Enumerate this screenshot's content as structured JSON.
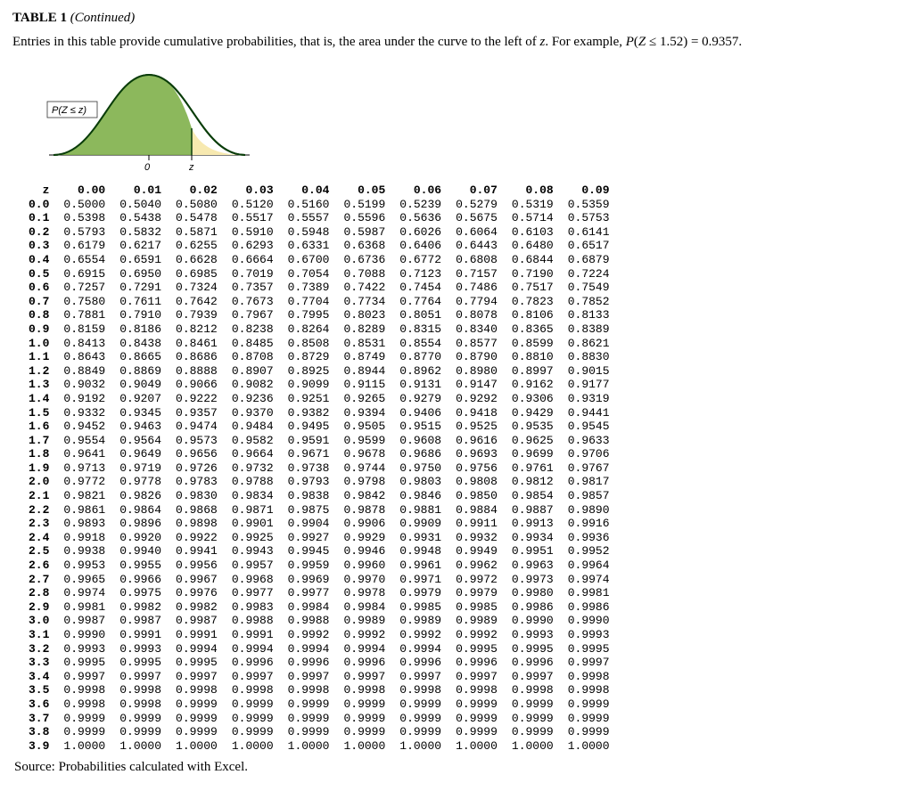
{
  "title_prefix": "TABLE 1 ",
  "title_paren": "(Continued)",
  "description_parts": {
    "p1": "Entries in this table provide cumulative probabilities, that is, the area under the curve to the left of ",
    "zvar": "z",
    "p2": ". For example, ",
    "pvar": "P",
    "p3": "(",
    "Zvar": "Z",
    "p4": " ≤ 1.52) = 0.9357."
  },
  "diagram": {
    "label_left": "P(Z ≤ z)",
    "tick0": "0",
    "tickz": "z"
  },
  "chart_data": {
    "type": "table",
    "title": "Standard normal cumulative distribution table",
    "corner_label": "z",
    "col_headers": [
      "0.00",
      "0.01",
      "0.02",
      "0.03",
      "0.04",
      "0.05",
      "0.06",
      "0.07",
      "0.08",
      "0.09"
    ],
    "row_labels": [
      "0.0",
      "0.1",
      "0.2",
      "0.3",
      "0.4",
      "0.5",
      "0.6",
      "0.7",
      "0.8",
      "0.9",
      "1.0",
      "1.1",
      "1.2",
      "1.3",
      "1.4",
      "1.5",
      "1.6",
      "1.7",
      "1.8",
      "1.9",
      "2.0",
      "2.1",
      "2.2",
      "2.3",
      "2.4",
      "2.5",
      "2.6",
      "2.7",
      "2.8",
      "2.9",
      "3.0",
      "3.1",
      "3.2",
      "3.3",
      "3.4",
      "3.5",
      "3.6",
      "3.7",
      "3.8",
      "3.9"
    ],
    "values": [
      [
        "0.5000",
        "0.5040",
        "0.5080",
        "0.5120",
        "0.5160",
        "0.5199",
        "0.5239",
        "0.5279",
        "0.5319",
        "0.5359"
      ],
      [
        "0.5398",
        "0.5438",
        "0.5478",
        "0.5517",
        "0.5557",
        "0.5596",
        "0.5636",
        "0.5675",
        "0.5714",
        "0.5753"
      ],
      [
        "0.5793",
        "0.5832",
        "0.5871",
        "0.5910",
        "0.5948",
        "0.5987",
        "0.6026",
        "0.6064",
        "0.6103",
        "0.6141"
      ],
      [
        "0.6179",
        "0.6217",
        "0.6255",
        "0.6293",
        "0.6331",
        "0.6368",
        "0.6406",
        "0.6443",
        "0.6480",
        "0.6517"
      ],
      [
        "0.6554",
        "0.6591",
        "0.6628",
        "0.6664",
        "0.6700",
        "0.6736",
        "0.6772",
        "0.6808",
        "0.6844",
        "0.6879"
      ],
      [
        "0.6915",
        "0.6950",
        "0.6985",
        "0.7019",
        "0.7054",
        "0.7088",
        "0.7123",
        "0.7157",
        "0.7190",
        "0.7224"
      ],
      [
        "0.7257",
        "0.7291",
        "0.7324",
        "0.7357",
        "0.7389",
        "0.7422",
        "0.7454",
        "0.7486",
        "0.7517",
        "0.7549"
      ],
      [
        "0.7580",
        "0.7611",
        "0.7642",
        "0.7673",
        "0.7704",
        "0.7734",
        "0.7764",
        "0.7794",
        "0.7823",
        "0.7852"
      ],
      [
        "0.7881",
        "0.7910",
        "0.7939",
        "0.7967",
        "0.7995",
        "0.8023",
        "0.8051",
        "0.8078",
        "0.8106",
        "0.8133"
      ],
      [
        "0.8159",
        "0.8186",
        "0.8212",
        "0.8238",
        "0.8264",
        "0.8289",
        "0.8315",
        "0.8340",
        "0.8365",
        "0.8389"
      ],
      [
        "0.8413",
        "0.8438",
        "0.8461",
        "0.8485",
        "0.8508",
        "0.8531",
        "0.8554",
        "0.8577",
        "0.8599",
        "0.8621"
      ],
      [
        "0.8643",
        "0.8665",
        "0.8686",
        "0.8708",
        "0.8729",
        "0.8749",
        "0.8770",
        "0.8790",
        "0.8810",
        "0.8830"
      ],
      [
        "0.8849",
        "0.8869",
        "0.8888",
        "0.8907",
        "0.8925",
        "0.8944",
        "0.8962",
        "0.8980",
        "0.8997",
        "0.9015"
      ],
      [
        "0.9032",
        "0.9049",
        "0.9066",
        "0.9082",
        "0.9099",
        "0.9115",
        "0.9131",
        "0.9147",
        "0.9162",
        "0.9177"
      ],
      [
        "0.9192",
        "0.9207",
        "0.9222",
        "0.9236",
        "0.9251",
        "0.9265",
        "0.9279",
        "0.9292",
        "0.9306",
        "0.9319"
      ],
      [
        "0.9332",
        "0.9345",
        "0.9357",
        "0.9370",
        "0.9382",
        "0.9394",
        "0.9406",
        "0.9418",
        "0.9429",
        "0.9441"
      ],
      [
        "0.9452",
        "0.9463",
        "0.9474",
        "0.9484",
        "0.9495",
        "0.9505",
        "0.9515",
        "0.9525",
        "0.9535",
        "0.9545"
      ],
      [
        "0.9554",
        "0.9564",
        "0.9573",
        "0.9582",
        "0.9591",
        "0.9599",
        "0.9608",
        "0.9616",
        "0.9625",
        "0.9633"
      ],
      [
        "0.9641",
        "0.9649",
        "0.9656",
        "0.9664",
        "0.9671",
        "0.9678",
        "0.9686",
        "0.9693",
        "0.9699",
        "0.9706"
      ],
      [
        "0.9713",
        "0.9719",
        "0.9726",
        "0.9732",
        "0.9738",
        "0.9744",
        "0.9750",
        "0.9756",
        "0.9761",
        "0.9767"
      ],
      [
        "0.9772",
        "0.9778",
        "0.9783",
        "0.9788",
        "0.9793",
        "0.9798",
        "0.9803",
        "0.9808",
        "0.9812",
        "0.9817"
      ],
      [
        "0.9821",
        "0.9826",
        "0.9830",
        "0.9834",
        "0.9838",
        "0.9842",
        "0.9846",
        "0.9850",
        "0.9854",
        "0.9857"
      ],
      [
        "0.9861",
        "0.9864",
        "0.9868",
        "0.9871",
        "0.9875",
        "0.9878",
        "0.9881",
        "0.9884",
        "0.9887",
        "0.9890"
      ],
      [
        "0.9893",
        "0.9896",
        "0.9898",
        "0.9901",
        "0.9904",
        "0.9906",
        "0.9909",
        "0.9911",
        "0.9913",
        "0.9916"
      ],
      [
        "0.9918",
        "0.9920",
        "0.9922",
        "0.9925",
        "0.9927",
        "0.9929",
        "0.9931",
        "0.9932",
        "0.9934",
        "0.9936"
      ],
      [
        "0.9938",
        "0.9940",
        "0.9941",
        "0.9943",
        "0.9945",
        "0.9946",
        "0.9948",
        "0.9949",
        "0.9951",
        "0.9952"
      ],
      [
        "0.9953",
        "0.9955",
        "0.9956",
        "0.9957",
        "0.9959",
        "0.9960",
        "0.9961",
        "0.9962",
        "0.9963",
        "0.9964"
      ],
      [
        "0.9965",
        "0.9966",
        "0.9967",
        "0.9968",
        "0.9969",
        "0.9970",
        "0.9971",
        "0.9972",
        "0.9973",
        "0.9974"
      ],
      [
        "0.9974",
        "0.9975",
        "0.9976",
        "0.9977",
        "0.9977",
        "0.9978",
        "0.9979",
        "0.9979",
        "0.9980",
        "0.9981"
      ],
      [
        "0.9981",
        "0.9982",
        "0.9982",
        "0.9983",
        "0.9984",
        "0.9984",
        "0.9985",
        "0.9985",
        "0.9986",
        "0.9986"
      ],
      [
        "0.9987",
        "0.9987",
        "0.9987",
        "0.9988",
        "0.9988",
        "0.9989",
        "0.9989",
        "0.9989",
        "0.9990",
        "0.9990"
      ],
      [
        "0.9990",
        "0.9991",
        "0.9991",
        "0.9991",
        "0.9992",
        "0.9992",
        "0.9992",
        "0.9992",
        "0.9993",
        "0.9993"
      ],
      [
        "0.9993",
        "0.9993",
        "0.9994",
        "0.9994",
        "0.9994",
        "0.9994",
        "0.9994",
        "0.9995",
        "0.9995",
        "0.9995"
      ],
      [
        "0.9995",
        "0.9995",
        "0.9995",
        "0.9996",
        "0.9996",
        "0.9996",
        "0.9996",
        "0.9996",
        "0.9996",
        "0.9997"
      ],
      [
        "0.9997",
        "0.9997",
        "0.9997",
        "0.9997",
        "0.9997",
        "0.9997",
        "0.9997",
        "0.9997",
        "0.9997",
        "0.9998"
      ],
      [
        "0.9998",
        "0.9998",
        "0.9998",
        "0.9998",
        "0.9998",
        "0.9998",
        "0.9998",
        "0.9998",
        "0.9998",
        "0.9998"
      ],
      [
        "0.9998",
        "0.9998",
        "0.9999",
        "0.9999",
        "0.9999",
        "0.9999",
        "0.9999",
        "0.9999",
        "0.9999",
        "0.9999"
      ],
      [
        "0.9999",
        "0.9999",
        "0.9999",
        "0.9999",
        "0.9999",
        "0.9999",
        "0.9999",
        "0.9999",
        "0.9999",
        "0.9999"
      ],
      [
        "0.9999",
        "0.9999",
        "0.9999",
        "0.9999",
        "0.9999",
        "0.9999",
        "0.9999",
        "0.9999",
        "0.9999",
        "0.9999"
      ],
      [
        "1.0000",
        "1.0000",
        "1.0000",
        "1.0000",
        "1.0000",
        "1.0000",
        "1.0000",
        "1.0000",
        "1.0000",
        "1.0000"
      ]
    ]
  },
  "source": "Source: Probabilities calculated with Excel."
}
